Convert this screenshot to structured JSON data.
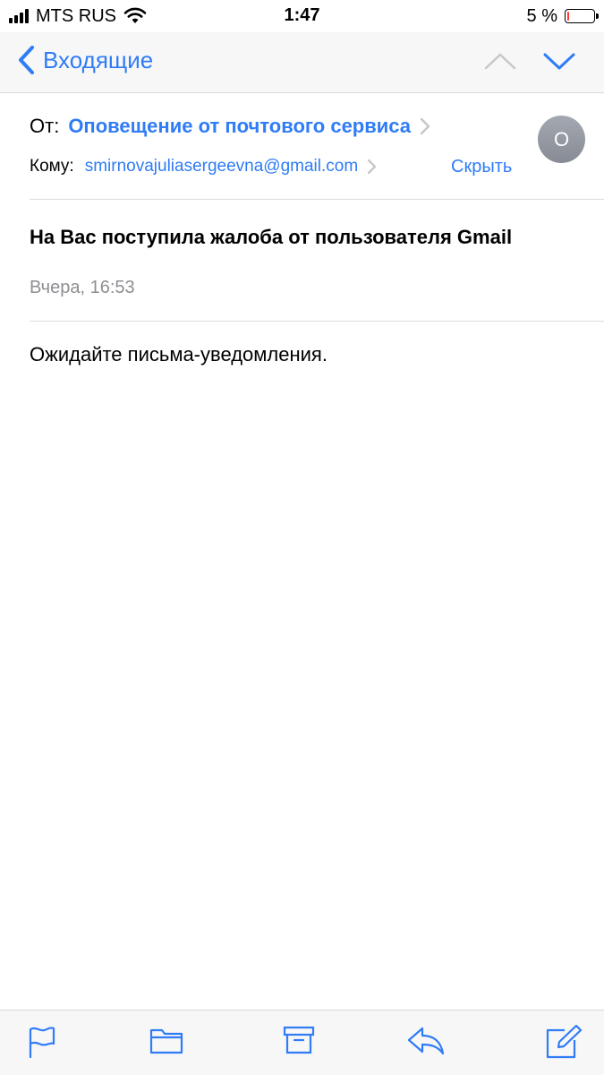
{
  "status_bar": {
    "carrier": "MTS RUS",
    "time": "1:47",
    "battery_percent": "5 %",
    "battery_level": 0.05,
    "battery_color": "#ff3b30"
  },
  "nav": {
    "back_label": "Входящие",
    "icons": [
      "chevron-left-icon",
      "chevron-up-icon",
      "chevron-down-icon"
    ],
    "accent_color": "#2f7cf6"
  },
  "message": {
    "from_label": "От:",
    "from_name": "Оповещение от почтового сервиса",
    "avatar_initial": "О",
    "to_label": "Кому:",
    "to_email": "smirnovajuliasergeevna@gmail.com",
    "hide_label": "Скрыть",
    "subject": "На Вас поступила жалоба от пользователя Gmail",
    "date": "Вчера, 16:53",
    "body": "Ожидайте письма-уведомления."
  },
  "toolbar": {
    "icons": [
      "flag-icon",
      "folder-icon",
      "archive-icon",
      "reply-icon",
      "compose-icon"
    ]
  }
}
